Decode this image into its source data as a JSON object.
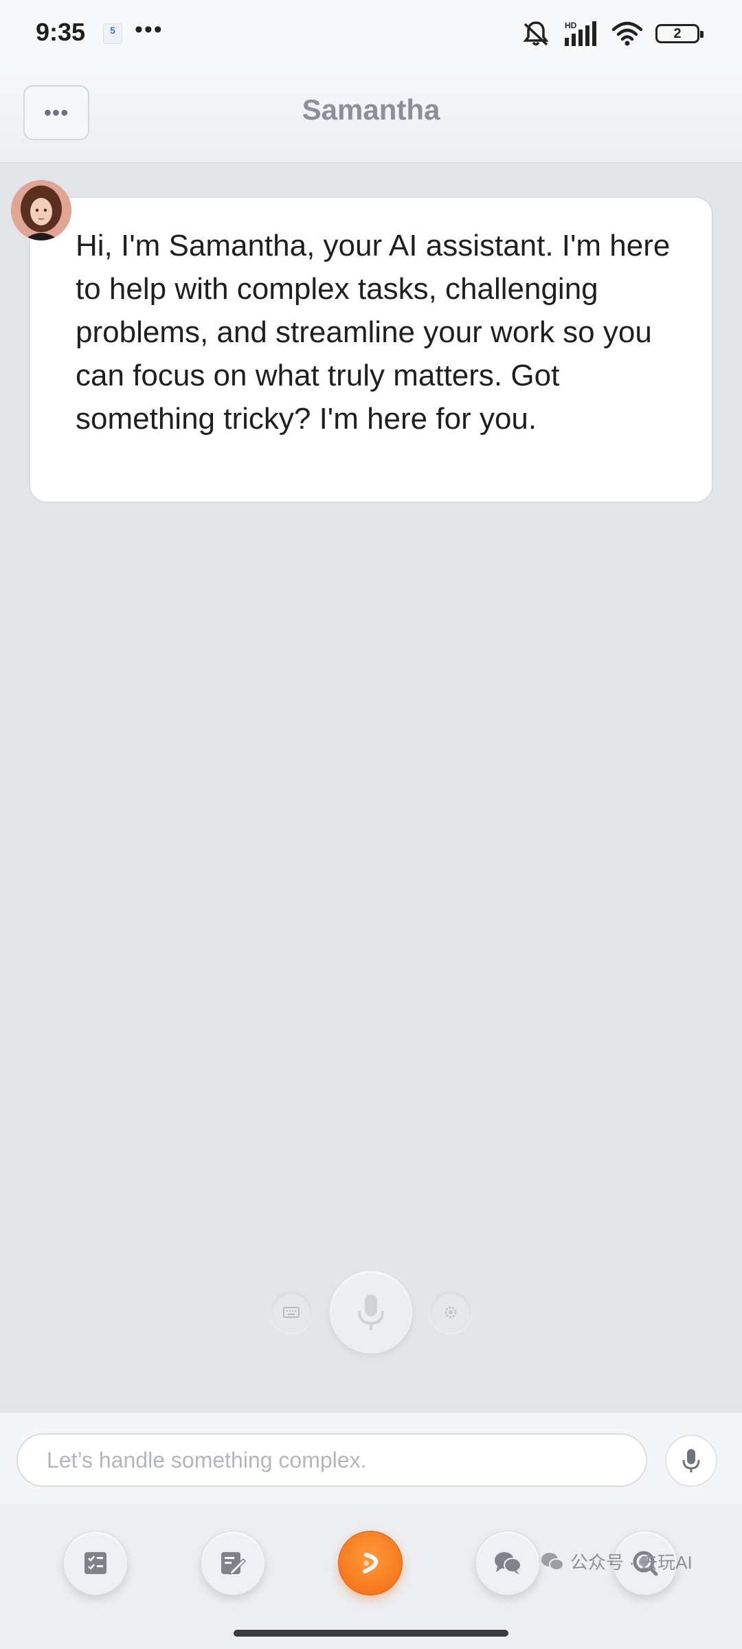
{
  "status_bar": {
    "time": "9:35",
    "notif_badge": "5",
    "more": "•••",
    "battery": "2",
    "icons": [
      "mute-icon",
      "hd-signal-icon",
      "wifi-icon",
      "battery-icon"
    ]
  },
  "header": {
    "menu_label": "•••",
    "title": "Samantha"
  },
  "chat": {
    "message": "Hi, I'm Samantha, your AI assistant. I'm here to help with complex tasks, challenging problems, and streamline your work so you can focus on what truly matters. Got something tricky? I'm here for you."
  },
  "voice_controls": {
    "icons": [
      "keyboard-icon",
      "microphone-icon",
      "settings-icon"
    ]
  },
  "input": {
    "placeholder": "Let’s handle something complex."
  },
  "bottom_nav": {
    "items": [
      "tasks-icon",
      "notes-icon",
      "assistant-icon",
      "chat-icon",
      "search-icon"
    ],
    "active_index": 2
  },
  "watermark": {
    "text": "公众号 · 去玩AI"
  },
  "colors": {
    "accent": "#f57c1f",
    "background": "#e3e5e9",
    "title": "#8a8f98"
  }
}
